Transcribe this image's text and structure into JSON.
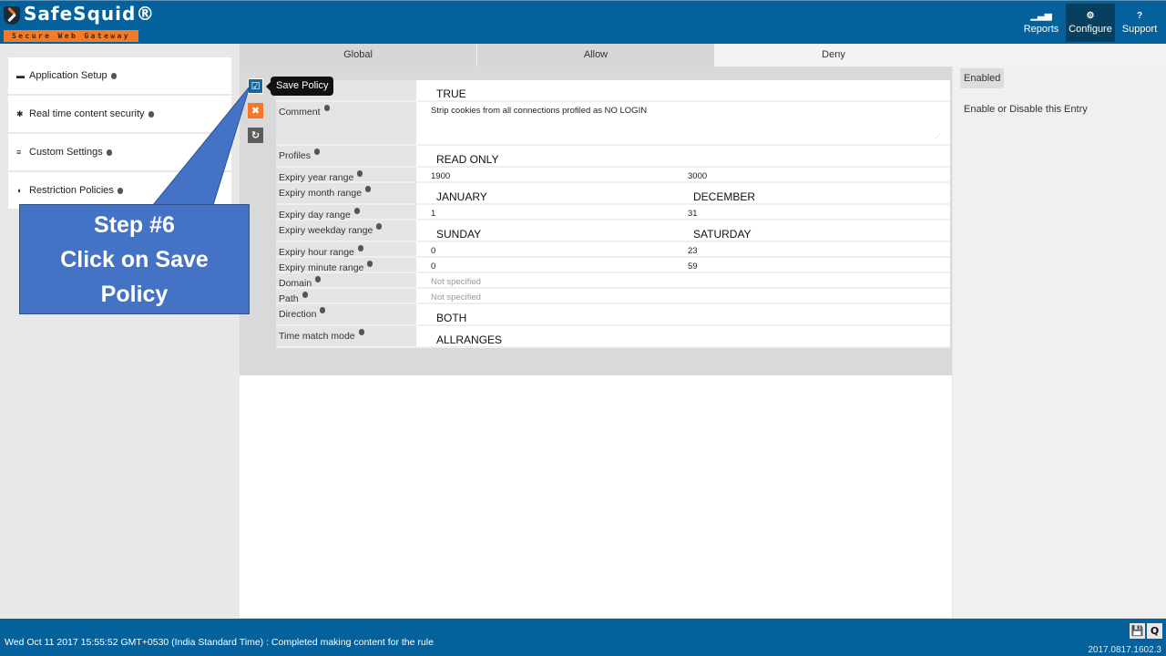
{
  "brand": {
    "name": "SafeSquid®",
    "tagline": "Secure Web Gateway"
  },
  "nav": [
    {
      "label": "Reports",
      "icon": "area-chart-icon",
      "glyph": "▁▃▅",
      "active": false
    },
    {
      "label": "Configure",
      "icon": "gears-icon",
      "glyph": "⚙",
      "active": true
    },
    {
      "label": "Support",
      "icon": "question-circle-icon",
      "glyph": "?",
      "active": false
    }
  ],
  "sidebar": {
    "items": [
      {
        "label": "Application Setup",
        "icon": "briefcase-icon",
        "glyph": "▬"
      },
      {
        "label": "Real time content security",
        "icon": "bug-icon",
        "glyph": "✱"
      },
      {
        "label": "Custom Settings",
        "icon": "sliders-icon",
        "glyph": "≡"
      },
      {
        "label": "Restriction Policies",
        "icon": "shield-icon",
        "glyph": "◖"
      }
    ]
  },
  "tabs": [
    {
      "label": "Global",
      "active": false
    },
    {
      "label": "Allow",
      "active": false
    },
    {
      "label": "Deny",
      "active": true
    }
  ],
  "actions": {
    "save_tooltip": "Save Policy"
  },
  "form": {
    "rows": [
      {
        "label": "",
        "values": [
          "TRUE"
        ],
        "style": "big"
      },
      {
        "label": "Comment",
        "values": [
          "Strip cookies from all connections profiled as NO LOGIN"
        ],
        "style": "textarea"
      },
      {
        "label": "Profiles",
        "values": [
          "READ ONLY"
        ],
        "style": "big"
      },
      {
        "label": "Expiry year range",
        "values": [
          "1900",
          "3000"
        ],
        "style": "small"
      },
      {
        "label": "Expiry month range",
        "values": [
          "JANUARY",
          "DECEMBER"
        ],
        "style": "big"
      },
      {
        "label": "Expiry day range",
        "values": [
          "1",
          "31"
        ],
        "style": "small"
      },
      {
        "label": "Expiry weekday range",
        "values": [
          "SUNDAY",
          "SATURDAY"
        ],
        "style": "big"
      },
      {
        "label": "Expiry hour range",
        "values": [
          "0",
          "23"
        ],
        "style": "small"
      },
      {
        "label": "Expiry minute range",
        "values": [
          "0",
          "59"
        ],
        "style": "small"
      },
      {
        "label": "Domain",
        "values": [
          "Not specified"
        ],
        "style": "muted"
      },
      {
        "label": "Path",
        "values": [
          "Not specified"
        ],
        "style": "muted"
      },
      {
        "label": "Direction",
        "values": [
          "BOTH"
        ],
        "style": "big"
      },
      {
        "label": "Time match mode",
        "values": [
          "ALLRANGES"
        ],
        "style": "big"
      }
    ]
  },
  "right_panel": {
    "badge": "Enabled",
    "description": "Enable or Disable this Entry"
  },
  "callout": {
    "line1": "Step #6",
    "line2": "Click on Save",
    "line3": "Policy",
    "color": "#4472c4"
  },
  "status": {
    "message": "Wed Oct 11 2017 15:55:52 GMT+0530 (India Standard Time) : Completed making content for the rule",
    "version": "2017.0817.1602.3"
  }
}
